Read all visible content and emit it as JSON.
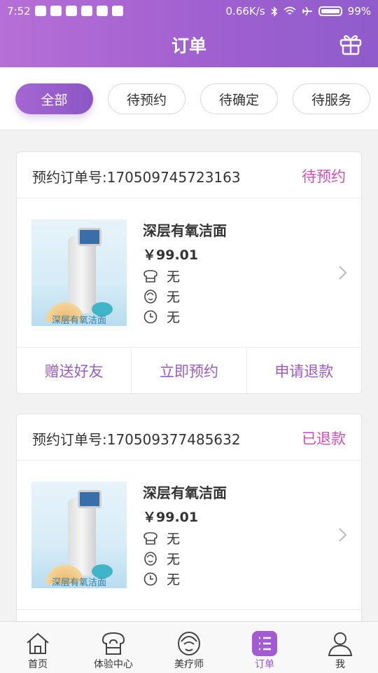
{
  "status_bar": {
    "time": "7:52",
    "speed": "0.66K/s",
    "battery": "99%"
  },
  "header": {
    "title": "订单",
    "right_icon": "gift-icon"
  },
  "tabs": [
    {
      "label": "全部",
      "active": true
    },
    {
      "label": "待预约",
      "active": false
    },
    {
      "label": "待确定",
      "active": false
    },
    {
      "label": "待服务",
      "active": false
    }
  ],
  "orders": [
    {
      "order_no": "预约订单号:170509745723163",
      "status": "待预约",
      "product": "深层有氧洁面",
      "price": "￥99.01",
      "store": "无",
      "therapist": "无",
      "time": "无",
      "image_caption": "深层有氧洁面",
      "actions": [
        "赠送好友",
        "立即预约",
        "申请退款"
      ]
    },
    {
      "order_no": "预约订单号:170509377485632",
      "status": "已退款",
      "product": "深层有氧洁面",
      "price": "￥99.01",
      "store": "无",
      "therapist": "无",
      "time": "无",
      "image_caption": "深层有氧洁面"
    }
  ],
  "bottom_nav": [
    {
      "label": "首页",
      "icon": "home-icon"
    },
    {
      "label": "体验中心",
      "icon": "store-icon"
    },
    {
      "label": "美疗师",
      "icon": "therapist-icon"
    },
    {
      "label": "订单",
      "icon": "order-list-icon",
      "active": true
    },
    {
      "label": "我",
      "icon": "user-icon"
    }
  ],
  "colors": {
    "accent": "#9b5cc6",
    "status_pink": "#d04fb5"
  }
}
